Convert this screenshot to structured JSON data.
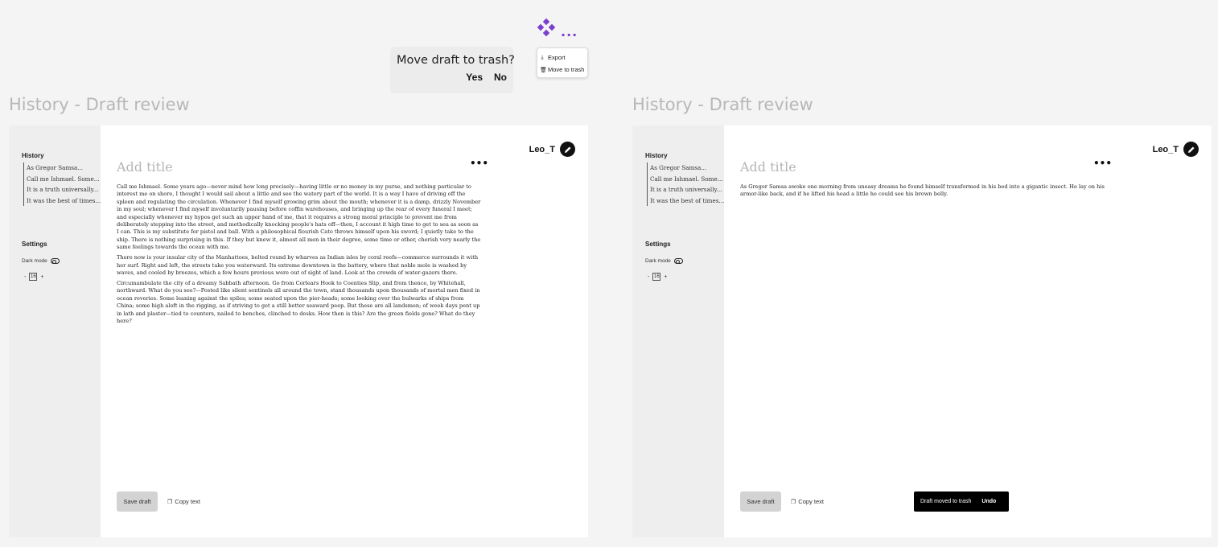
{
  "top": {
    "confirm_question": "Move draft to trash?",
    "confirm_yes": "Yes",
    "confirm_no": "No",
    "dots": "...",
    "menu": [
      {
        "icon": "export-icon",
        "label": "Export"
      },
      {
        "icon": "trash-icon",
        "label": "Move to trash"
      }
    ],
    "accent_color": "#7b3fd0"
  },
  "frames": [
    {
      "title": "History - Draft review",
      "sidebar": {
        "history_heading": "History",
        "history_items": [
          "As Gregor Samsa...",
          "Call me Ishmael. Some...",
          "It is a truth universally...",
          "It was the best of times..."
        ],
        "settings_heading": "Settings",
        "dark_mode_label": "Dark mode",
        "minus": "-",
        "font_size": "16",
        "plus": "+"
      },
      "user": "Leo_T",
      "more": "•••",
      "title_placeholder": "Add title",
      "paragraphs": [
        "Call me Ishmael. Some years ago—never mind how long precisely—having little or no money in my purse, and nothing particular to interest me on shore, I thought I would sail about a little and see the watery part of the world. It is a way I have of driving off the spleen and regulating the circulation. Whenever I find myself growing grim about the mouth; whenever it is a damp, drizzly November in my soul; whenever I find myself involuntarily pausing before coffin warehouses, and bringing up the rear of every funeral I meet; and especially whenever my hypos get such an upper hand of me, that it requires a strong moral principle to prevent me from deliberately stepping into the street, and methodically knocking people's hats off—then, I account it high time to get to sea as soon as I can. This is my substitute for pistol and ball. With a philosophical flourish Cato throws himself upon his sword; I quietly take to the ship. There is nothing surprising in this. If they but knew it, almost all men in their degree, some time or other, cherish very nearly the same feelings towards the ocean with me.",
        "There now is your insular city of the Manhattoes, belted round by wharves as Indian isles by coral reefs—commerce surrounds it with her surf. Right and left, the streets take you waterward. Its extreme downtown is the battery, where that noble mole is washed by waves, and cooled by breezes, which a few hours previous were out of sight of land. Look at the crowds of water-gazers there.",
        "Circumambulate the city of a dreamy Sabbath afternoon. Go from Corlears Hook to Coenties Slip, and from thence, by Whitehall, northward. What do you see?—Posted like silent sentinels all around the town, stand thousands upon thousands of mortal men fixed in ocean reveries. Some leaning against the spiles; some seated upon the pier-heads; some looking over the bulwarks of ships from China; some high aloft in the rigging, as if striving to get a still better seaward peep. But these are all landsmen; of week days pent up in lath and plaster—tied to counters, nailed to benches, clinched to desks. How then is this? Are the green fields gone? What do they here?"
      ],
      "save_label": "Save draft",
      "copy_label": "Copy text"
    },
    {
      "title": "History - Draft review",
      "sidebar": {
        "history_heading": "History",
        "history_items": [
          "As Gregor Samsa...",
          "Call me Ishmael. Some...",
          "It is a truth universally...",
          "It was the best of times..."
        ],
        "settings_heading": "Settings",
        "dark_mode_label": "Dark mode",
        "minus": "-",
        "font_size": "16",
        "plus": "+"
      },
      "user": "Leo_T",
      "more": "•••",
      "title_placeholder": "Add title",
      "paragraphs": [
        "As Gregor Samsa awoke one morning from uneasy dreams he found himself transformed in his bed into a gigantic insect. He lay on his armor-like back, and if he lifted his head a little he could see his brown belly."
      ],
      "save_label": "Save draft",
      "copy_label": "Copy text",
      "toast_text": "Draft moved to trash",
      "toast_action": "Undo"
    }
  ]
}
